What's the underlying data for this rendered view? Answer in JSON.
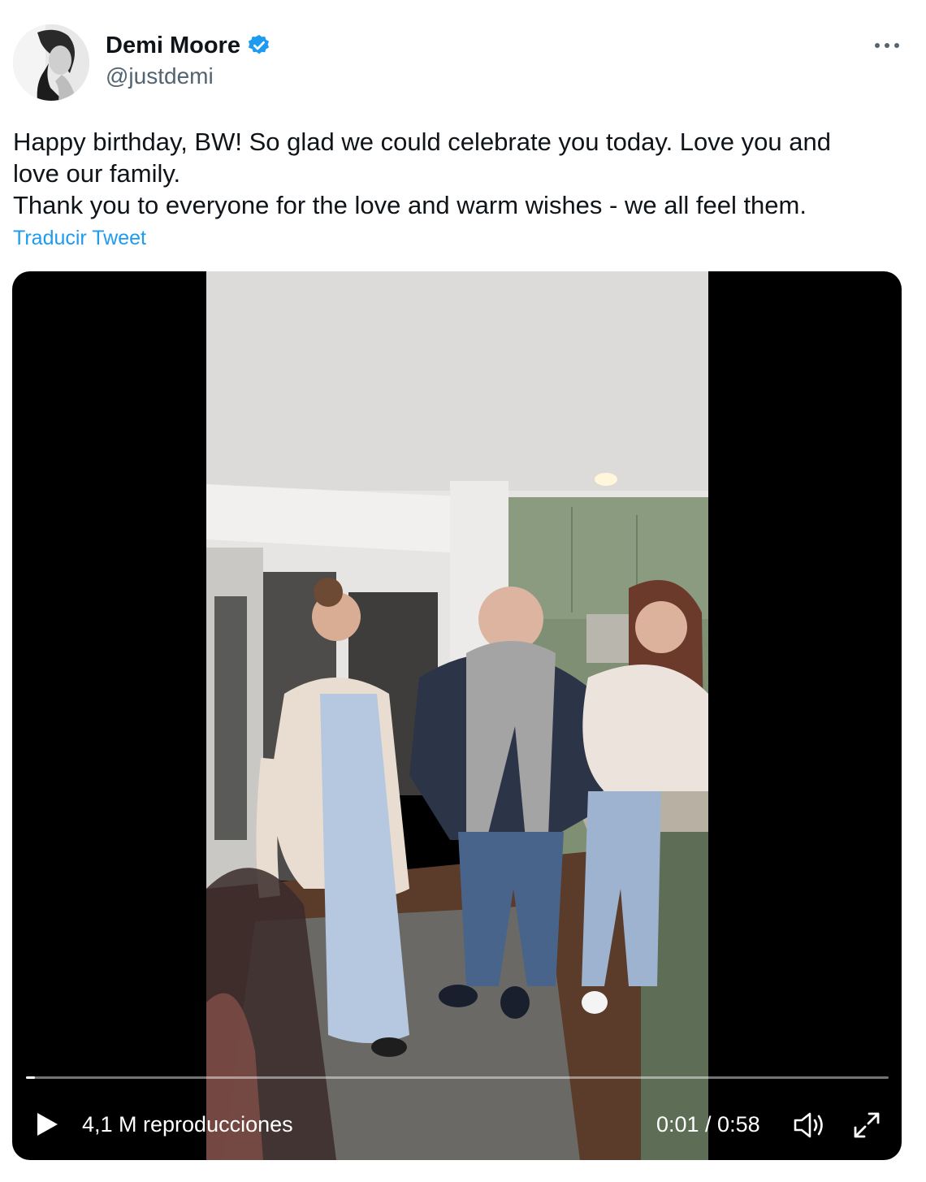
{
  "author": {
    "display_name": "Demi Moore",
    "handle": "@justdemi",
    "verified": true,
    "avatar_icon": "profile-photo-avatar"
  },
  "tweet": {
    "text": "Happy birthday, BW! So glad we could celebrate you today. Love you and\nlove our family.\nThank you to everyone for the love and warm wishes - we all feel them.",
    "translate_label": "Traducir Tweet"
  },
  "video": {
    "views_label": "4,1 M reproducciones",
    "time_label": "0:01 / 0:58",
    "progress": 0.01,
    "icons": {
      "play": "play-icon",
      "volume": "volume-icon",
      "fullscreen": "fullscreen-icon",
      "more": "more-icon"
    }
  },
  "colors": {
    "link": "#1d9bf0",
    "verified": "#1d9bf0",
    "secondary_text": "#536471",
    "primary_text": "#0f1419"
  }
}
